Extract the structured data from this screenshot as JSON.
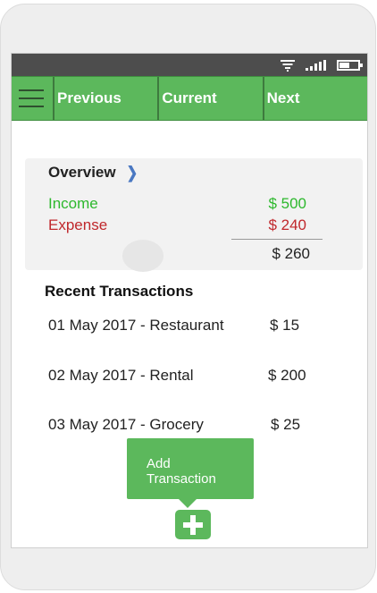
{
  "status_bar": {
    "wifi_icon": "wifi-icon",
    "signal_icon": "signal-icon",
    "battery_icon": "battery-icon"
  },
  "nav": {
    "menu_icon": "hamburger-icon",
    "tabs": [
      {
        "label": "Previous"
      },
      {
        "label": "Current"
      },
      {
        "label": "Next"
      }
    ]
  },
  "overview": {
    "title": "Overview",
    "chevron_icon": "chevron-right-icon",
    "income_label": "Income",
    "income_value": "$ 500",
    "expense_label": "Expense",
    "expense_value": "$ 240",
    "balance_value": "$ 260"
  },
  "recent": {
    "title": "Recent Transactions",
    "items": [
      {
        "label": "01 May 2017 - Restaurant",
        "amount": "$ 15"
      },
      {
        "label": "02 May 2017 - Rental",
        "amount": "$ 200"
      },
      {
        "label": "03 May 2017 - Grocery",
        "amount": "$ 25"
      }
    ]
  },
  "add": {
    "tooltip_line1": "Add",
    "tooltip_line2": "Transaction",
    "icon": "plus-icon"
  },
  "colors": {
    "accent": "#5cb85c",
    "income": "#2db82d",
    "expense": "#c0282c",
    "status_bar": "#4d4d4d"
  }
}
